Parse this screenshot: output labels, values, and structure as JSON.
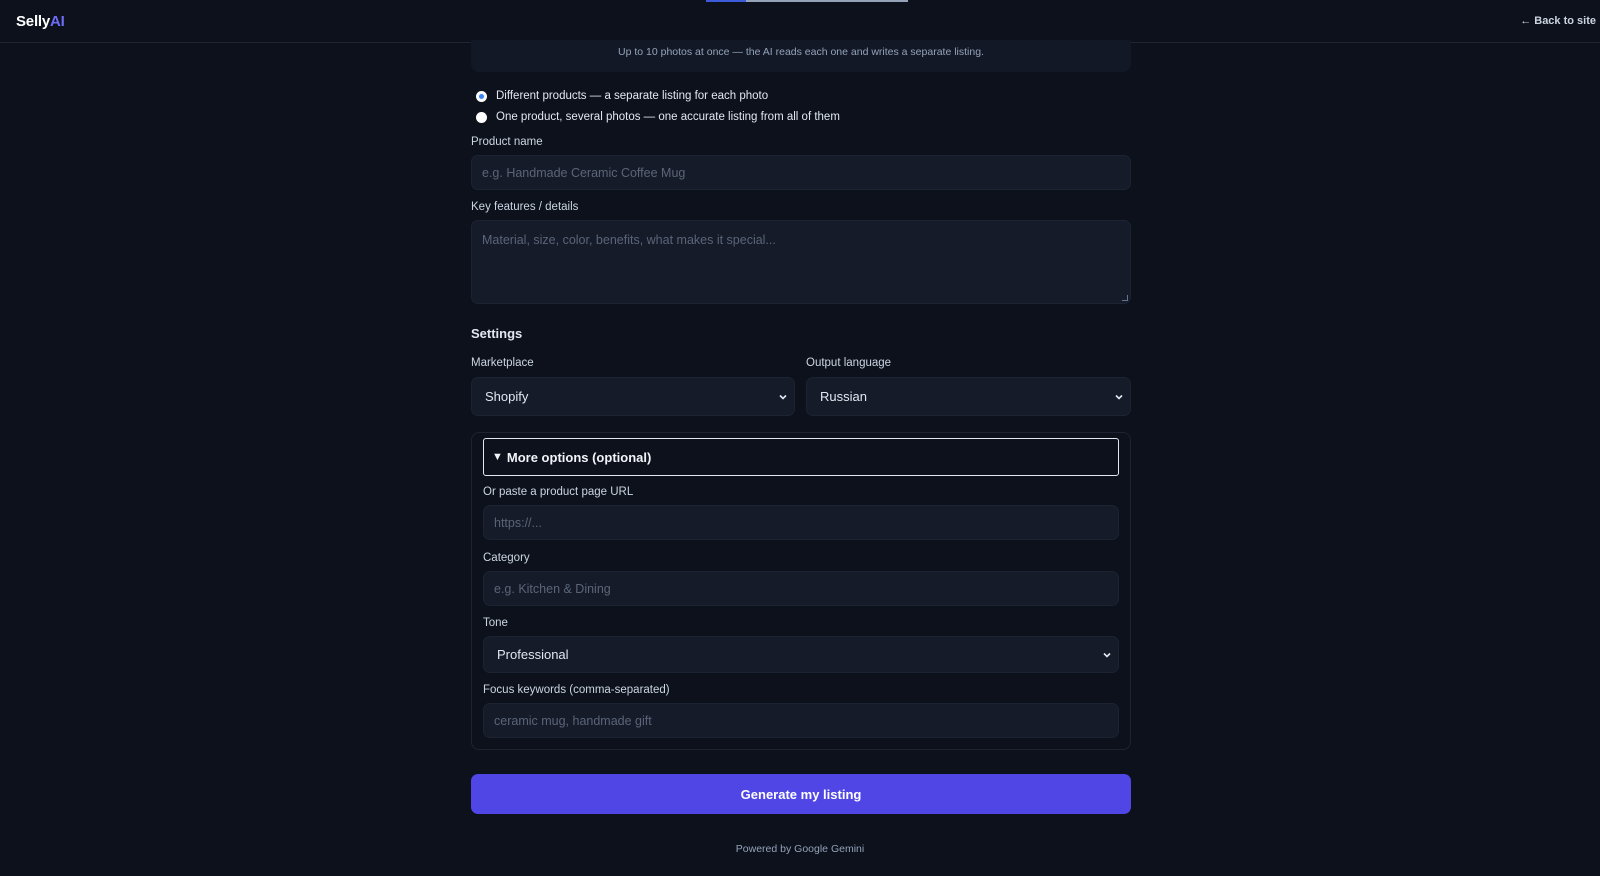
{
  "header": {
    "logo_main": "Selly",
    "logo_accent": "AI",
    "back_link": "← Back to site"
  },
  "upload": {
    "hint": "Up to 10 photos at once — the AI reads each one and writes a separate listing."
  },
  "mode": {
    "options": [
      {
        "label": "Different products — a separate listing for each photo",
        "checked": true
      },
      {
        "label": "One product, several photos — one accurate listing from all of them",
        "checked": false
      }
    ]
  },
  "product_name": {
    "label": "Product name",
    "placeholder": "e.g. Handmade Ceramic Coffee Mug",
    "value": ""
  },
  "features": {
    "label": "Key features / details",
    "placeholder": "Material, size, color, benefits, what makes it special...",
    "value": ""
  },
  "settings": {
    "title": "Settings",
    "marketplace": {
      "label": "Marketplace",
      "value": "Shopify"
    },
    "language": {
      "label": "Output language",
      "value": "Russian"
    }
  },
  "more_options": {
    "summary": "More options (optional)",
    "url": {
      "label": "Or paste a product page URL",
      "placeholder": "https://..."
    },
    "category": {
      "label": "Category",
      "placeholder": "e.g. Kitchen & Dining"
    },
    "tone": {
      "label": "Tone",
      "value": "Professional"
    },
    "keywords": {
      "label": "Focus keywords (comma-separated)",
      "placeholder": "ceramic mug, handmade gift"
    }
  },
  "generate_button": "Generate my listing",
  "footer": "Powered by Google Gemini",
  "colors": {
    "background": "#0c111c",
    "accent": "#4f46e5",
    "logo_accent": "#6d6cf5",
    "radio_checked": "#3b82f6"
  },
  "icons": {
    "select_arrow": "chevron-down-icon",
    "summary_marker": "triangle-down-icon"
  }
}
